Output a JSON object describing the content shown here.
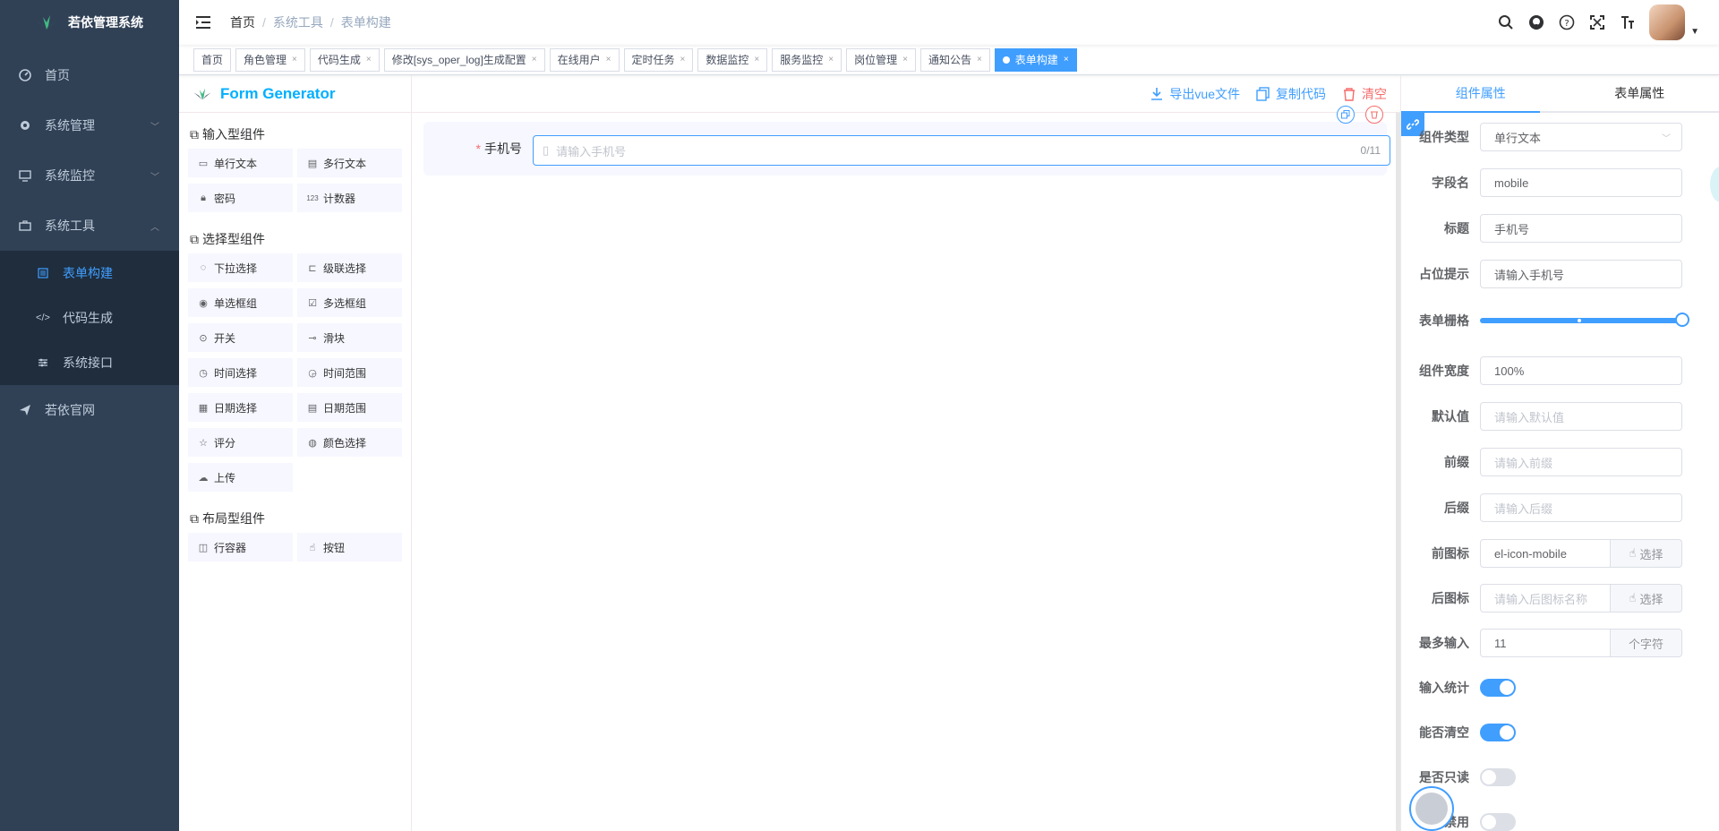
{
  "app": {
    "title": "若依管理系统"
  },
  "sidebar": {
    "items": [
      {
        "label": "首页",
        "icon": "dashboard-icon"
      },
      {
        "label": "系统管理",
        "icon": "gear-icon"
      },
      {
        "label": "系统监控",
        "icon": "monitor-icon"
      },
      {
        "label": "系统工具",
        "icon": "toolbox-icon"
      }
    ],
    "sub_items": [
      {
        "label": "表单构建",
        "icon": "form-icon"
      },
      {
        "label": "代码生成",
        "icon": "code-icon"
      },
      {
        "label": "系统接口",
        "icon": "sliders-icon"
      }
    ],
    "last_item": {
      "label": "若依官网",
      "icon": "send-icon"
    }
  },
  "breadcrumb": [
    "首页",
    "系统工具",
    "表单构建"
  ],
  "tags": [
    {
      "label": "首页"
    },
    {
      "label": "角色管理"
    },
    {
      "label": "代码生成"
    },
    {
      "label": "修改[sys_oper_log]生成配置"
    },
    {
      "label": "在线用户"
    },
    {
      "label": "定时任务"
    },
    {
      "label": "数据监控"
    },
    {
      "label": "服务监控"
    },
    {
      "label": "岗位管理"
    },
    {
      "label": "通知公告"
    },
    {
      "label": "表单构建"
    }
  ],
  "left_panel": {
    "title": "Form Generator",
    "groups": [
      {
        "title": "输入型组件",
        "items": [
          "单行文本",
          "多行文本",
          "密码",
          "计数器"
        ]
      },
      {
        "title": "选择型组件",
        "items": [
          "下拉选择",
          "级联选择",
          "单选框组",
          "多选框组",
          "开关",
          "滑块",
          "时间选择",
          "时间范围",
          "日期选择",
          "日期范围",
          "评分",
          "颜色选择",
          "上传"
        ]
      },
      {
        "title": "布局型组件",
        "items": [
          "行容器",
          "按钮"
        ]
      }
    ]
  },
  "center": {
    "actions": {
      "export": "导出vue文件",
      "copy": "复制代码",
      "clear": "清空"
    },
    "field": {
      "label": "手机号",
      "placeholder": "请输入手机号",
      "count": "0/11"
    }
  },
  "right_panel": {
    "tabs": [
      "组件属性",
      "表单属性"
    ],
    "rows": [
      {
        "label": "组件类型",
        "value": "单行文本"
      },
      {
        "label": "字段名",
        "value": "mobile"
      },
      {
        "label": "标题",
        "value": "手机号"
      },
      {
        "label": "占位提示",
        "value": "请输入手机号"
      },
      {
        "label": "表单栅格",
        "value": ""
      },
      {
        "label": "组件宽度",
        "value": "100%"
      },
      {
        "label": "默认值",
        "value": "请输入默认值"
      },
      {
        "label": "前缀",
        "value": "请输入前缀"
      },
      {
        "label": "后缀",
        "value": "请输入后缀"
      },
      {
        "label": "前图标",
        "value": "el-icon-mobile",
        "append": "选择"
      },
      {
        "label": "后图标",
        "value": "请输入后图标名称",
        "append": "选择"
      },
      {
        "label": "最多输入",
        "value": "11",
        "append": "个字符"
      },
      {
        "label": "输入统计",
        "value": ""
      },
      {
        "label": "能否清空",
        "value": ""
      },
      {
        "label": "是否只读",
        "value": ""
      },
      {
        "label": "是否禁用",
        "value": ""
      }
    ],
    "grid_span_fraction": 1.0,
    "switches": {
      "show_word_limit": true,
      "clearable": true,
      "readonly": false,
      "disabled": false
    }
  },
  "colors": {
    "sidebar": "#304156",
    "primary": "#409eff",
    "danger": "#f56c6c",
    "brand_title": "#00afff"
  }
}
